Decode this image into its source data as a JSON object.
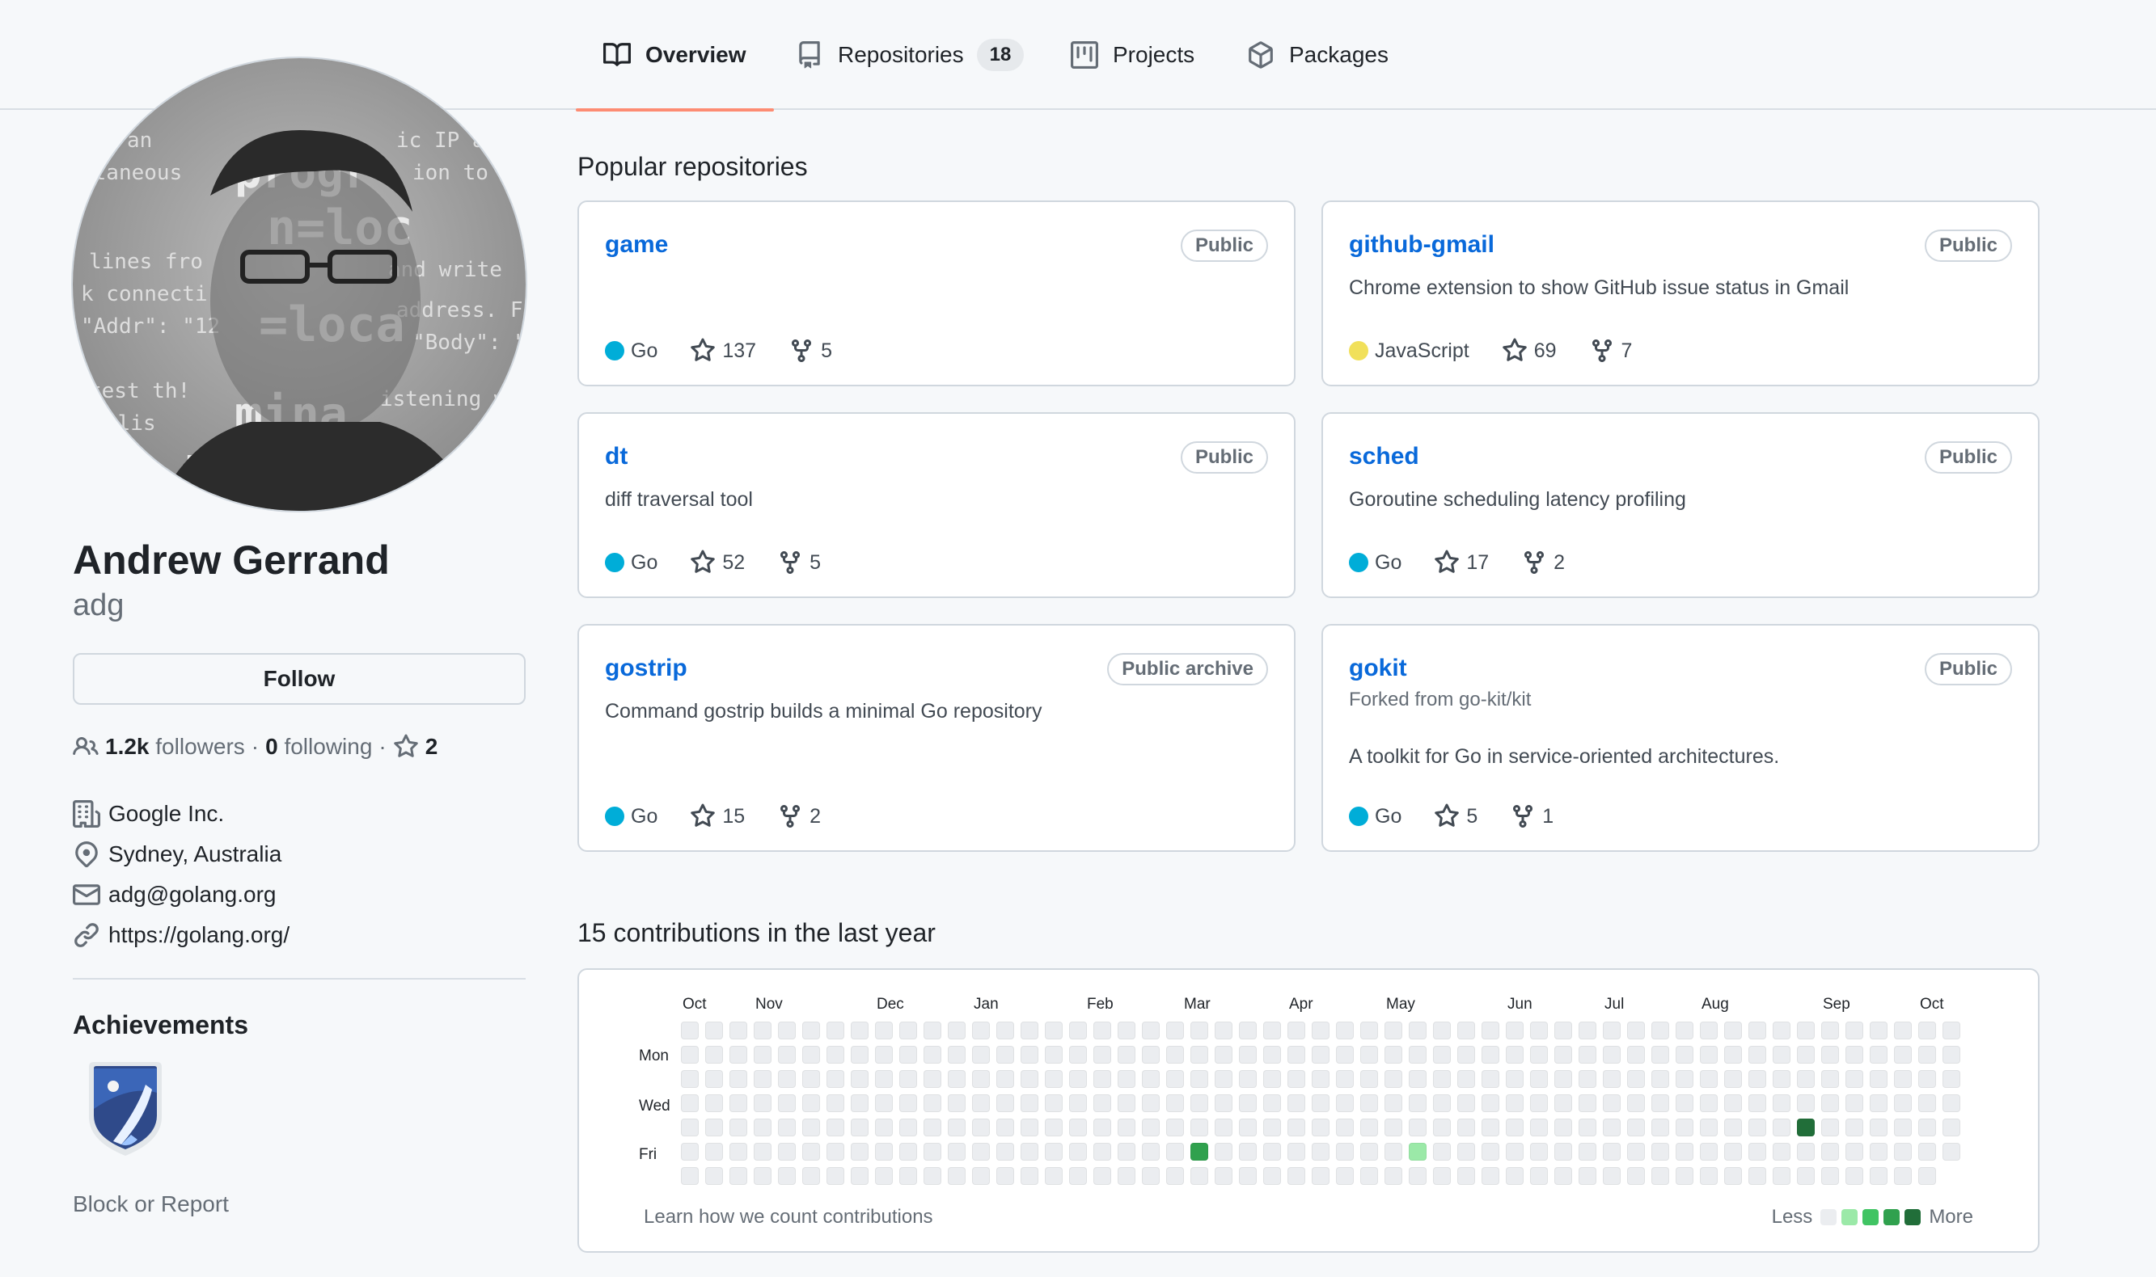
{
  "nav": {
    "tabs": [
      {
        "label": "Overview",
        "icon": "book-icon",
        "active": true
      },
      {
        "label": "Repositories",
        "icon": "repo-icon",
        "count": "18"
      },
      {
        "label": "Projects",
        "icon": "project-icon"
      },
      {
        "label": "Packages",
        "icon": "package-icon"
      }
    ]
  },
  "profile": {
    "name": "Andrew Gerrand",
    "login": "adg",
    "follow_label": "Follow",
    "followers_count": "1.2k",
    "followers_label": "followers",
    "sep1": "·",
    "following_count": "0",
    "following_label": "following",
    "sep2": "·",
    "stars_count": "2",
    "company": "Google Inc.",
    "location": "Sydney, Australia",
    "email": "adg@golang.org",
    "website": "https://golang.org/",
    "achievements_title": "Achievements",
    "block_label": "Block or Report"
  },
  "popular": {
    "title": "Popular repositories",
    "repos": [
      {
        "name": "game",
        "visibility": "Public",
        "description": "",
        "language": "Go",
        "lang_color": "#00ADD8",
        "stars": "137",
        "forks": "5"
      },
      {
        "name": "github-gmail",
        "visibility": "Public",
        "description": "Chrome extension to show GitHub issue status in Gmail",
        "language": "JavaScript",
        "lang_color": "#f1e05a",
        "stars": "69",
        "forks": "7"
      },
      {
        "name": "dt",
        "visibility": "Public",
        "description": "diff traversal tool",
        "language": "Go",
        "lang_color": "#00ADD8",
        "stars": "52",
        "forks": "5"
      },
      {
        "name": "sched",
        "visibility": "Public",
        "description": "Goroutine scheduling latency profiling",
        "language": "Go",
        "lang_color": "#00ADD8",
        "stars": "17",
        "forks": "2"
      },
      {
        "name": "gostrip",
        "visibility": "Public archive",
        "description": "Command gostrip builds a minimal Go repository",
        "language": "Go",
        "lang_color": "#00ADD8",
        "stars": "15",
        "forks": "2"
      },
      {
        "name": "gokit",
        "visibility": "Public",
        "forked_from": "Forked from go-kit/kit",
        "description": "A toolkit for Go in service-oriented architectures.",
        "language": "Go",
        "lang_color": "#00ADD8",
        "stars": "5",
        "forks": "1"
      }
    ]
  },
  "contributions": {
    "title": "15 contributions in the last year",
    "months": [
      "Oct",
      "Nov",
      "Dec",
      "Jan",
      "Feb",
      "Mar",
      "Apr",
      "May",
      "Jun",
      "Jul",
      "Aug",
      "Sep",
      "Oct"
    ],
    "days": [
      "Mon",
      "Wed",
      "Fri"
    ],
    "learn_label": "Learn how we count contributions",
    "less_label": "Less",
    "more_label": "More",
    "colors": [
      "#ebedf0",
      "#9be9a8",
      "#40c463",
      "#30a14e",
      "#216e39"
    ]
  }
}
